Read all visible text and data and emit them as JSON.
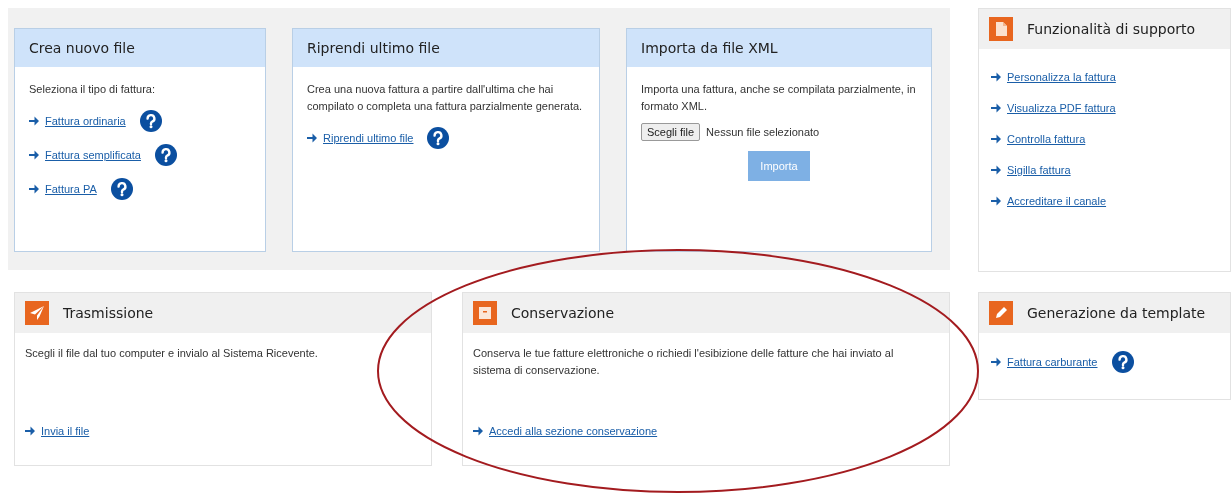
{
  "top_cards": [
    {
      "kind": "links",
      "title": "Crea nuovo file",
      "description": "Seleziona il tipo di fattura:",
      "links": [
        {
          "label": "Fattura ordinaria",
          "help": true
        },
        {
          "label": "Fattura semplificata",
          "help": true
        },
        {
          "label": "Fattura PA",
          "help": true
        }
      ]
    },
    {
      "kind": "links",
      "title": "Riprendi ultimo file",
      "description": "Crea una nuova fattura a partire dall'ultima che hai compilato o completa una fattura parzialmente generata.",
      "links": [
        {
          "label": "Riprendi ultimo file",
          "help": true
        }
      ]
    },
    {
      "kind": "import",
      "title": "Importa da file XML",
      "description": "Importa una fattura, anche se compilata parzialmente, in formato XML.",
      "file_button": "Scegli file",
      "file_status": "Nessun file selezionato",
      "submit": {
        "label": "Importa",
        "disabled": true
      }
    }
  ],
  "bottom_cards": [
    {
      "kind": "send",
      "title": "Trasmissione",
      "description": "Scegli il file dal tuo computer e invialo al Sistema Ricevente.",
      "links": [
        {
          "label": "Invia il file",
          "help": false
        }
      ]
    },
    {
      "kind": "box",
      "title": "Conservazione",
      "description": "Conserva le tue fatture elettroniche o richiedi l'esibizione delle fatture che hai inviato al sistema di conservazione.",
      "links": [
        {
          "label": "Accedi alla sezione conservazione",
          "help": false
        }
      ]
    }
  ],
  "side_cards": [
    {
      "kind": "document",
      "title": "Funzionalità di supporto",
      "links": [
        {
          "label": "Personalizza la fattura",
          "help": false
        },
        {
          "label": "Visualizza PDF fattura",
          "help": false
        },
        {
          "label": "Controlla fattura",
          "help": false
        },
        {
          "label": "Sigilla fattura",
          "help": false
        },
        {
          "label": "Accreditare il canale",
          "help": false
        }
      ]
    },
    {
      "kind": "pencil",
      "title": "Generazione da template",
      "links": [
        {
          "label": "Fattura carburante",
          "help": true
        }
      ]
    }
  ],
  "annotation": {
    "kind": "ellipse"
  }
}
